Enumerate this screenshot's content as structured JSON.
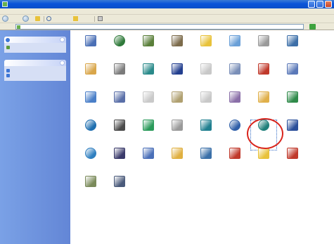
{
  "window": {
    "title": ""
  },
  "menu": [
    {
      "label": ""
    },
    {
      "label": ""
    },
    {
      "label": ""
    },
    {
      "label": ""
    },
    {
      "label": ""
    },
    {
      "label": ""
    }
  ],
  "toolbar": {
    "back_label": "",
    "search_label": "",
    "folders_label": ""
  },
  "address": {
    "value": "",
    "go_label": ""
  },
  "taskpane": {
    "box1": {
      "title": "",
      "links": [
        {
          "label": ""
        }
      ]
    },
    "box2": {
      "title": "",
      "links": [
        {
          "label": ""
        },
        {
          "label": ""
        }
      ]
    }
  },
  "items": [
    {
      "label": "",
      "icon": "display-icon",
      "color": "#4a6fb5"
    },
    {
      "label": "",
      "icon": "internet-options-icon",
      "color": "#2f7a3a"
    },
    {
      "label": "",
      "icon": "wrench-icon",
      "color": "#5a7f3a"
    },
    {
      "label": "",
      "icon": "admin-tools-icon",
      "color": "#7c6b4b"
    },
    {
      "label": "",
      "icon": "folder-icon",
      "color": "#e8c23a"
    },
    {
      "label": "",
      "icon": "windows-update-icon",
      "color": "#6aa0d8"
    },
    {
      "label": "",
      "icon": "fonts-icon",
      "color": "#9a9a9a"
    },
    {
      "label": "",
      "icon": "mouse-icon",
      "color": "#3d6fa8"
    },
    {
      "label": "",
      "icon": "paint-icon",
      "color": "#d9a64a"
    },
    {
      "label": "",
      "icon": "printers-icon",
      "color": "#7b7b7b"
    },
    {
      "label": "",
      "icon": "user-accounts-icon",
      "color": "#2a8a8a"
    },
    {
      "label": "",
      "icon": "quicktime-icon",
      "color": "#233f8f"
    },
    {
      "label": "",
      "icon": "phone-modem-icon",
      "color": "#c8c8c8"
    },
    {
      "label": "",
      "icon": "scheduled-tasks-icon",
      "color": "#7a8fb8"
    },
    {
      "label": "",
      "icon": "network-icon",
      "color": "#c0392b"
    },
    {
      "label": "",
      "icon": "mail-icon",
      "color": "#5a78b8"
    },
    {
      "label": "",
      "icon": "accessibility-icon",
      "color": "#4a7fc8"
    },
    {
      "label": "",
      "icon": "add-programs-icon",
      "color": "#5a6fa8"
    },
    {
      "label": "",
      "icon": "sounds-icon",
      "color": "#c9c9c9"
    },
    {
      "label": "",
      "icon": "pen-icon",
      "color": "#b0a070"
    },
    {
      "label": "",
      "icon": "speech-icon",
      "color": "#c8c8c8"
    },
    {
      "label": "",
      "icon": "system-icon",
      "color": "#8a6fa8"
    },
    {
      "label": "",
      "icon": "regional-icon",
      "color": "#e0b04a"
    },
    {
      "label": "",
      "icon": "network-connections-icon",
      "color": "#2f8a4a"
    },
    {
      "label": "",
      "icon": "taskbar-icon",
      "color": "#1f6fb0"
    },
    {
      "label": "",
      "icon": "java-icon",
      "color": "#4a4a4a"
    },
    {
      "label": "",
      "icon": "accessibility-wizard-icon",
      "color": "#2a9a5a"
    },
    {
      "label": "",
      "icon": "keyboard-icon",
      "color": "#9a9a9a"
    },
    {
      "label": "",
      "icon": "user-icon",
      "color": "#1f7f8f"
    },
    {
      "label": "",
      "icon": "clock-icon",
      "color": "#2f5fa8"
    },
    {
      "label": "",
      "icon": "security-center-icon",
      "color": "#1e7f7a"
    },
    {
      "label": "",
      "icon": "programs-icon",
      "color": "#2a4f9a"
    },
    {
      "label": "",
      "icon": "search-icon",
      "color": "#2f7fc0"
    },
    {
      "label": "",
      "icon": "tools-icon",
      "color": "#3a3a6a"
    },
    {
      "label": "",
      "icon": "game-controllers-icon",
      "color": "#4a6fb8"
    },
    {
      "label": "",
      "icon": "power-icon",
      "color": "#e0b040"
    },
    {
      "label": "",
      "icon": "disk-icon",
      "color": "#3a6fa8"
    },
    {
      "label": "",
      "icon": "security-icon",
      "color": "#c0392b"
    },
    {
      "label": "",
      "icon": "folder-options-icon",
      "color": "#e8c23a"
    },
    {
      "label": "",
      "icon": "firewall-icon",
      "color": "#c0392b"
    },
    {
      "label": "",
      "icon": "scanner-icon",
      "color": "#7a8a5a"
    },
    {
      "label": "",
      "icon": "phone-icon",
      "color": "#4a5a7a"
    }
  ]
}
